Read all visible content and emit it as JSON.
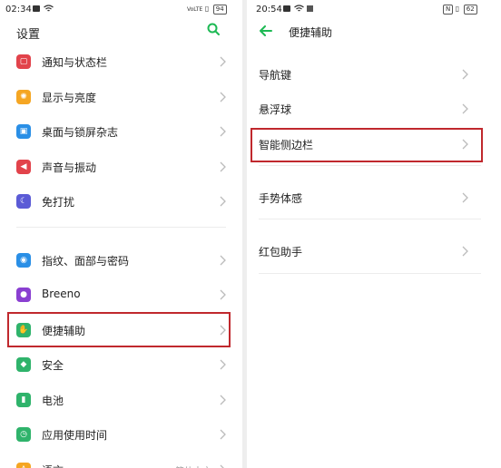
{
  "left_phone": {
    "status": {
      "time": "02:34",
      "network": "VoLTE",
      "battery": "94"
    },
    "title": "设置",
    "groups": [
      [
        {
          "label": "通知与状态栏",
          "icon": "notification-icon",
          "color": "#e2434b"
        },
        {
          "label": "显示与亮度",
          "icon": "brightness-icon",
          "color": "#f5a623"
        },
        {
          "label": "桌面与锁屏杂志",
          "icon": "wallpaper-icon",
          "color": "#2a8fe6"
        },
        {
          "label": "声音与振动",
          "icon": "sound-icon",
          "color": "#e2434b"
        },
        {
          "label": "免打扰",
          "icon": "moon-icon",
          "color": "#5b5bd6"
        }
      ],
      [
        {
          "label": "指纹、面部与密码",
          "icon": "fingerprint-icon",
          "color": "#2a8fe6"
        },
        {
          "label": "Breeno",
          "icon": "breeno-icon",
          "color": "#8a3fd1"
        },
        {
          "label": "便捷辅助",
          "icon": "assist-icon",
          "color": "#2fb36b",
          "highlighted": true
        },
        {
          "label": "安全",
          "icon": "shield-icon",
          "color": "#2fb36b"
        },
        {
          "label": "电池",
          "icon": "battery-icon",
          "color": "#2fb36b"
        },
        {
          "label": "应用使用时间",
          "icon": "app-usage-icon",
          "color": "#2fb36b"
        },
        {
          "label": "语言",
          "icon": "language-icon",
          "color": "#f5a623",
          "value": "简体中文"
        }
      ]
    ]
  },
  "right_phone": {
    "status": {
      "time": "20:54",
      "battery": "62"
    },
    "title": "便捷辅助",
    "items": [
      {
        "label": "导航键"
      },
      {
        "label": "悬浮球"
      },
      {
        "label": "智能侧边栏",
        "highlighted": true
      },
      {
        "label": "手势体感"
      },
      {
        "label": "红包助手"
      }
    ]
  },
  "colors": {
    "accent": "#1db954",
    "highlight": "#c0282d",
    "divider": "#ececec"
  }
}
